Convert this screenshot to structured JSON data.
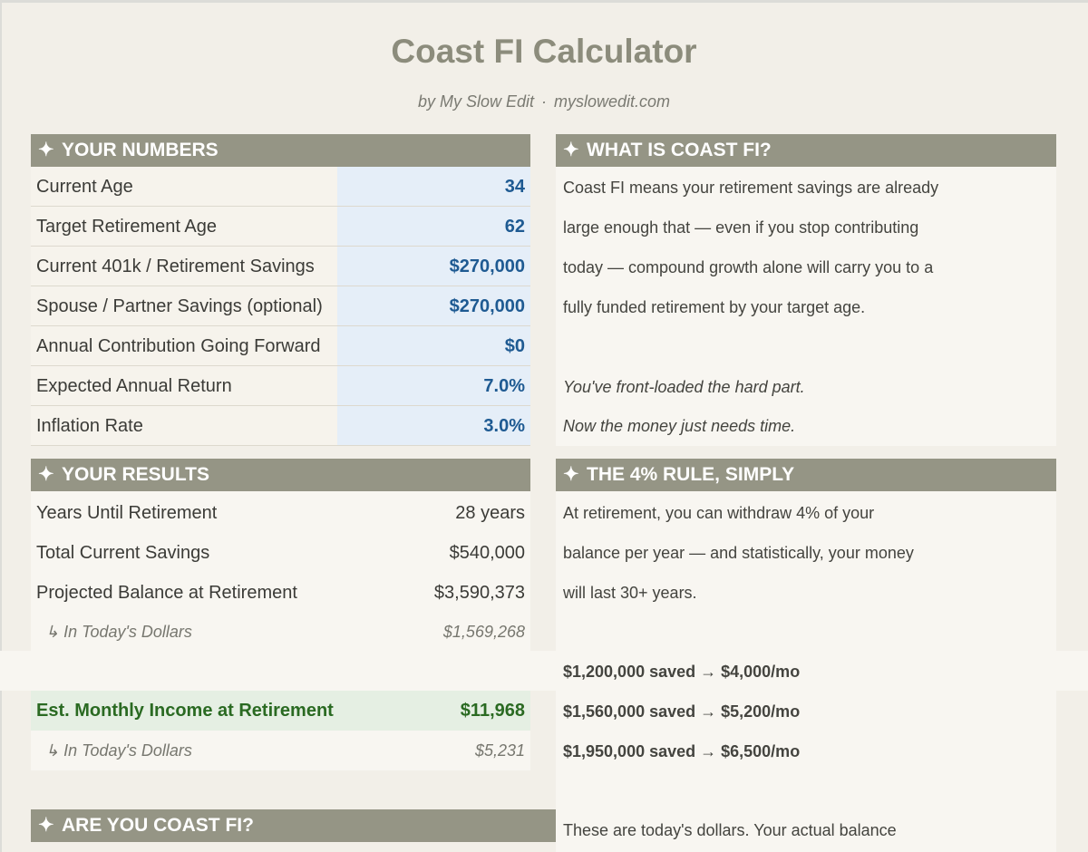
{
  "title": "Coast FI Calculator",
  "subtitle": {
    "author": "by My Slow Edit",
    "separator": "·",
    "site": "myslowedit.com"
  },
  "your_numbers": {
    "header": "YOUR NUMBERS",
    "rows": [
      {
        "label": "Current Age",
        "value": "34"
      },
      {
        "label": "Target Retirement Age",
        "value": "62"
      },
      {
        "label": "Current 401k / Retirement Savings",
        "value": "$270,000"
      },
      {
        "label": "Spouse / Partner Savings (optional)",
        "value": "$270,000"
      },
      {
        "label": "Annual Contribution Going Forward",
        "value": "$0"
      },
      {
        "label": "Expected Annual Return",
        "value": "7.0%"
      },
      {
        "label": "Inflation Rate",
        "value": "3.0%"
      }
    ]
  },
  "what_is_coast_fi": {
    "header": "WHAT IS COAST FI?",
    "lines": [
      "Coast FI means your retirement savings are already",
      "large enough that — even if you stop contributing",
      "today — compound growth alone will carry you to a",
      "fully funded retirement by your target age."
    ],
    "italic_lines": [
      "You've front-loaded the hard part.",
      "Now the money just needs time."
    ]
  },
  "your_results": {
    "header": "YOUR RESULTS",
    "rows": [
      {
        "label": "Years Until Retirement",
        "value": "28 years"
      },
      {
        "label": "Total Current Savings",
        "value": "$540,000"
      },
      {
        "label": "Projected Balance at Retirement",
        "value": "$3,590,373"
      }
    ],
    "balance_today": {
      "label": "↳ In Today's Dollars",
      "value": "$1,569,268"
    },
    "monthly_income": {
      "label": "Est. Monthly Income at Retirement",
      "value": "$11,968"
    },
    "income_today": {
      "label": "↳ In Today's Dollars",
      "value": "$5,231"
    }
  },
  "four_percent_rule": {
    "header": "THE 4% RULE, SIMPLY",
    "lines": [
      "At retirement, you can withdraw 4% of your",
      "balance per year — and statistically, your money",
      "will last 30+ years."
    ],
    "examples": [
      "$1,200,000 saved → $4,000/mo",
      "$1,560,000 saved → $5,200/mo",
      "$1,950,000 saved → $6,500/mo"
    ],
    "note": "These are today's dollars. Your actual balance"
  },
  "are_you_coast_fi": {
    "header": "ARE YOU COAST FI?"
  },
  "icons": {
    "section_marker": "✦"
  },
  "colors": {
    "header_bg": "#959585",
    "input_value": "#1e5a92",
    "input_bg": "#e5eef8",
    "income_green": "#2a6a22",
    "income_bg": "#e5efe3"
  }
}
